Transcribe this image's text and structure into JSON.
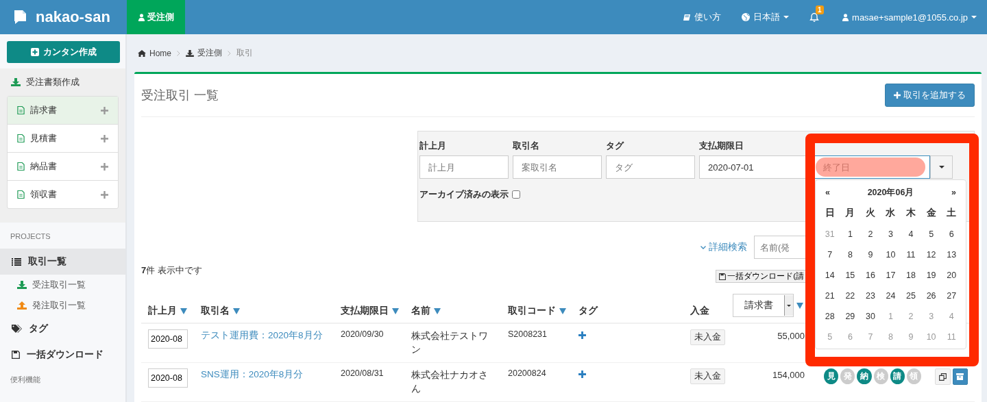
{
  "header": {
    "logo": "nakao-san",
    "side_tab": {
      "label": "受注側",
      "selected": true
    },
    "help": "使い方",
    "language": "日本語",
    "notifications": "1",
    "user": "masae+sample1@1055.co.jp"
  },
  "sidebar": {
    "create_button": "カンタン作成",
    "doc_section": "受注書類作成",
    "doc_items": [
      {
        "label": "請求書",
        "selected": true
      },
      {
        "label": "見積書",
        "selected": false
      },
      {
        "label": "納品書",
        "selected": false
      },
      {
        "label": "領収書",
        "selected": false
      }
    ],
    "projects_label": "PROJECTS",
    "nav": [
      {
        "label": "取引一覧",
        "kind": "list",
        "selected": true,
        "children": [
          {
            "label": "受注取引一覧",
            "kind": "inbound"
          },
          {
            "label": "発注取引一覧",
            "kind": "outbound"
          }
        ]
      },
      {
        "label": "タグ",
        "kind": "tag",
        "selected": false
      },
      {
        "label": "一括ダウンロード",
        "kind": "save",
        "selected": false
      }
    ],
    "features_label": "便利機能"
  },
  "breadcrumb": [
    {
      "label": "Home",
      "kind": "home"
    },
    {
      "label": "受注側",
      "kind": "inbound"
    },
    {
      "label": "取引",
      "kind": "current"
    }
  ],
  "page": {
    "title": "受注取引 一覧",
    "add_button": "取引を追加する"
  },
  "filters": {
    "fields": [
      {
        "label": "計上月",
        "placeholder": "計上月"
      },
      {
        "label": "取引名",
        "placeholder": "案取引名"
      },
      {
        "label": "タグ",
        "placeholder": "タグ"
      },
      {
        "label": "支払期限日",
        "value": "2020-07-01"
      }
    ],
    "end_date": {
      "placeholder": "終了日"
    },
    "archive": {
      "label": "アーカイブ済みの表示",
      "checked": false
    }
  },
  "datepicker": {
    "prev": "«",
    "title": "2020年06月",
    "next": "»",
    "weekdays": [
      "日",
      "月",
      "火",
      "水",
      "木",
      "金",
      "土"
    ],
    "weeks": [
      [
        {
          "day": "31",
          "muted": true
        },
        {
          "day": "1",
          "muted": false
        },
        {
          "day": "2",
          "muted": false
        },
        {
          "day": "3",
          "muted": false
        },
        {
          "day": "4",
          "muted": false
        },
        {
          "day": "5",
          "muted": false
        },
        {
          "day": "6",
          "muted": false
        }
      ],
      [
        {
          "day": "7",
          "muted": false
        },
        {
          "day": "8",
          "muted": false
        },
        {
          "day": "9",
          "muted": false
        },
        {
          "day": "10",
          "muted": false
        },
        {
          "day": "11",
          "muted": false
        },
        {
          "day": "12",
          "muted": false
        },
        {
          "day": "13",
          "muted": false
        }
      ],
      [
        {
          "day": "14",
          "muted": false
        },
        {
          "day": "15",
          "muted": false
        },
        {
          "day": "16",
          "muted": false
        },
        {
          "day": "17",
          "muted": false
        },
        {
          "day": "18",
          "muted": false
        },
        {
          "day": "19",
          "muted": false
        },
        {
          "day": "20",
          "muted": false
        }
      ],
      [
        {
          "day": "21",
          "muted": false
        },
        {
          "day": "22",
          "muted": false
        },
        {
          "day": "23",
          "muted": false
        },
        {
          "day": "24",
          "muted": false
        },
        {
          "day": "25",
          "muted": false
        },
        {
          "day": "26",
          "muted": false
        },
        {
          "day": "27",
          "muted": false
        }
      ],
      [
        {
          "day": "28",
          "muted": false
        },
        {
          "day": "29",
          "muted": false
        },
        {
          "day": "30",
          "muted": false
        },
        {
          "day": "1",
          "muted": true
        },
        {
          "day": "2",
          "muted": true
        },
        {
          "day": "3",
          "muted": true
        },
        {
          "day": "4",
          "muted": true
        }
      ],
      [
        {
          "day": "5",
          "muted": true
        },
        {
          "day": "6",
          "muted": true
        },
        {
          "day": "7",
          "muted": true
        },
        {
          "day": "8",
          "muted": true
        },
        {
          "day": "9",
          "muted": true
        },
        {
          "day": "10",
          "muted": true
        },
        {
          "day": "11",
          "muted": true
        }
      ]
    ]
  },
  "search": {
    "advanced_link": "詳細検索",
    "name_placeholder": "名前(発"
  },
  "count": {
    "number": "7",
    "text": "件 表示中です"
  },
  "bulk_download": "一括ダウンロード(請",
  "table": {
    "columns": [
      {
        "label": "計上月",
        "sortable": true
      },
      {
        "label": "取引名",
        "sortable": true
      },
      {
        "label": "支払期限日",
        "sortable": true
      },
      {
        "label": "名前",
        "sortable": true
      },
      {
        "label": "取引コード",
        "sortable": true
      },
      {
        "label": "タグ",
        "sortable": false
      },
      {
        "label": "入金",
        "sortable": false
      }
    ],
    "doc_select": "請求書",
    "rows": [
      {
        "month": "2020-08",
        "name": "テスト運用費：2020年8月分",
        "due": "2020/09/30",
        "client": "株式会社テストワン",
        "code": "S2008231",
        "payment": "未入金",
        "amount": "55,000"
      },
      {
        "month": "2020-08",
        "name": "SNS運用：2020年8月分",
        "due": "2020/08/31",
        "client": "株式会社ナカオさん",
        "code": "20200824",
        "payment": "未入金",
        "amount": "154,000",
        "docs": [
          {
            "label": "見",
            "on": true
          },
          {
            "label": "発",
            "on": false
          },
          {
            "label": "納",
            "on": true
          },
          {
            "label": "検",
            "on": false
          },
          {
            "label": "請",
            "on": true
          },
          {
            "label": "領",
            "on": false
          }
        ],
        "actions": true
      }
    ]
  },
  "annotations": {
    "frame": true,
    "highlight": true
  }
}
